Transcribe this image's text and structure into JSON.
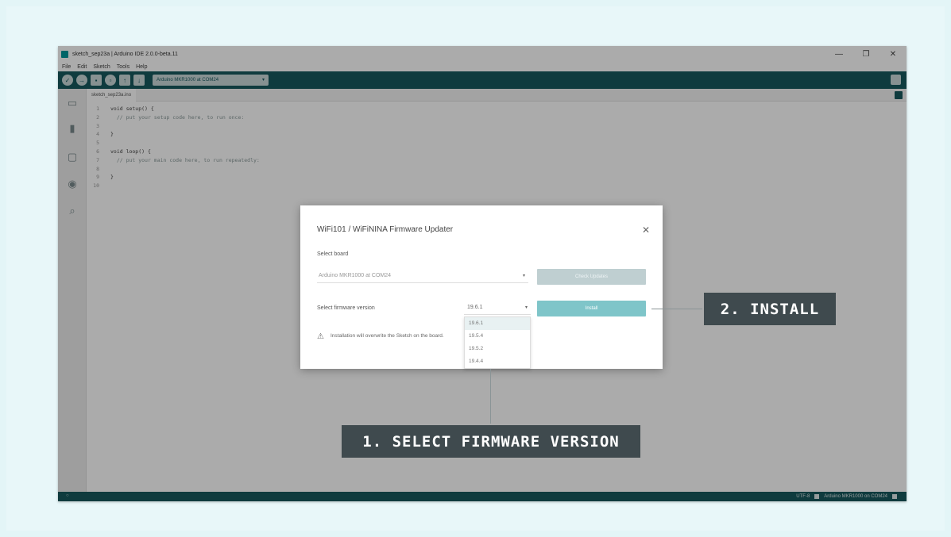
{
  "window": {
    "title": "sketch_sep23a | Arduino IDE 2.0.0-beta.11",
    "controls": [
      "—",
      "❐",
      "✕"
    ]
  },
  "menu": [
    "File",
    "Edit",
    "Sketch",
    "Tools",
    "Help"
  ],
  "toolbar": {
    "board_select": "Arduino MKR1000 at COM24",
    "caret": "▾"
  },
  "editor": {
    "tab_label": "sketch_sep23a.ino",
    "lines": [
      {
        "n": "1",
        "code": "void setup() {",
        "comment": false
      },
      {
        "n": "2",
        "code": "  // put your setup code here, to run once:",
        "comment": true
      },
      {
        "n": "3",
        "code": "",
        "comment": false
      },
      {
        "n": "4",
        "code": "}",
        "comment": false
      },
      {
        "n": "5",
        "code": "",
        "comment": false
      },
      {
        "n": "6",
        "code": "void loop() {",
        "comment": false
      },
      {
        "n": "7",
        "code": "  // put your main code here, to run repeatedly:",
        "comment": true
      },
      {
        "n": "8",
        "code": "",
        "comment": false
      },
      {
        "n": "9",
        "code": "}",
        "comment": false
      },
      {
        "n": "10",
        "code": "",
        "comment": false
      }
    ]
  },
  "status": {
    "left": "○",
    "encoding": "UTF-8",
    "board": "Arduino MKR1000 on COM24"
  },
  "dialog": {
    "title": "WiFi101 / WiFiNINA Firmware Updater",
    "close": "✕",
    "select_board_label": "Select board",
    "board_value": "Arduino MKR1000 at COM24",
    "check_button": "Check Updates",
    "select_fw_label": "Select firmware version",
    "fw_value": "19.6.1",
    "install_button": "Install",
    "warning_icon": "⚠",
    "warning_text": "Installation will overwrite the Sketch on the board.",
    "fw_options": [
      "19.6.1",
      "19.5.4",
      "19.5.2",
      "19.4.4"
    ]
  },
  "callouts": {
    "install": "2. INSTALL",
    "select": "1. SELECT FIRMWARE VERSION"
  },
  "colors": {
    "teal_dark": "#17585d",
    "teal_light": "#7fc5c9",
    "callout_bg": "#3f4a4e"
  }
}
